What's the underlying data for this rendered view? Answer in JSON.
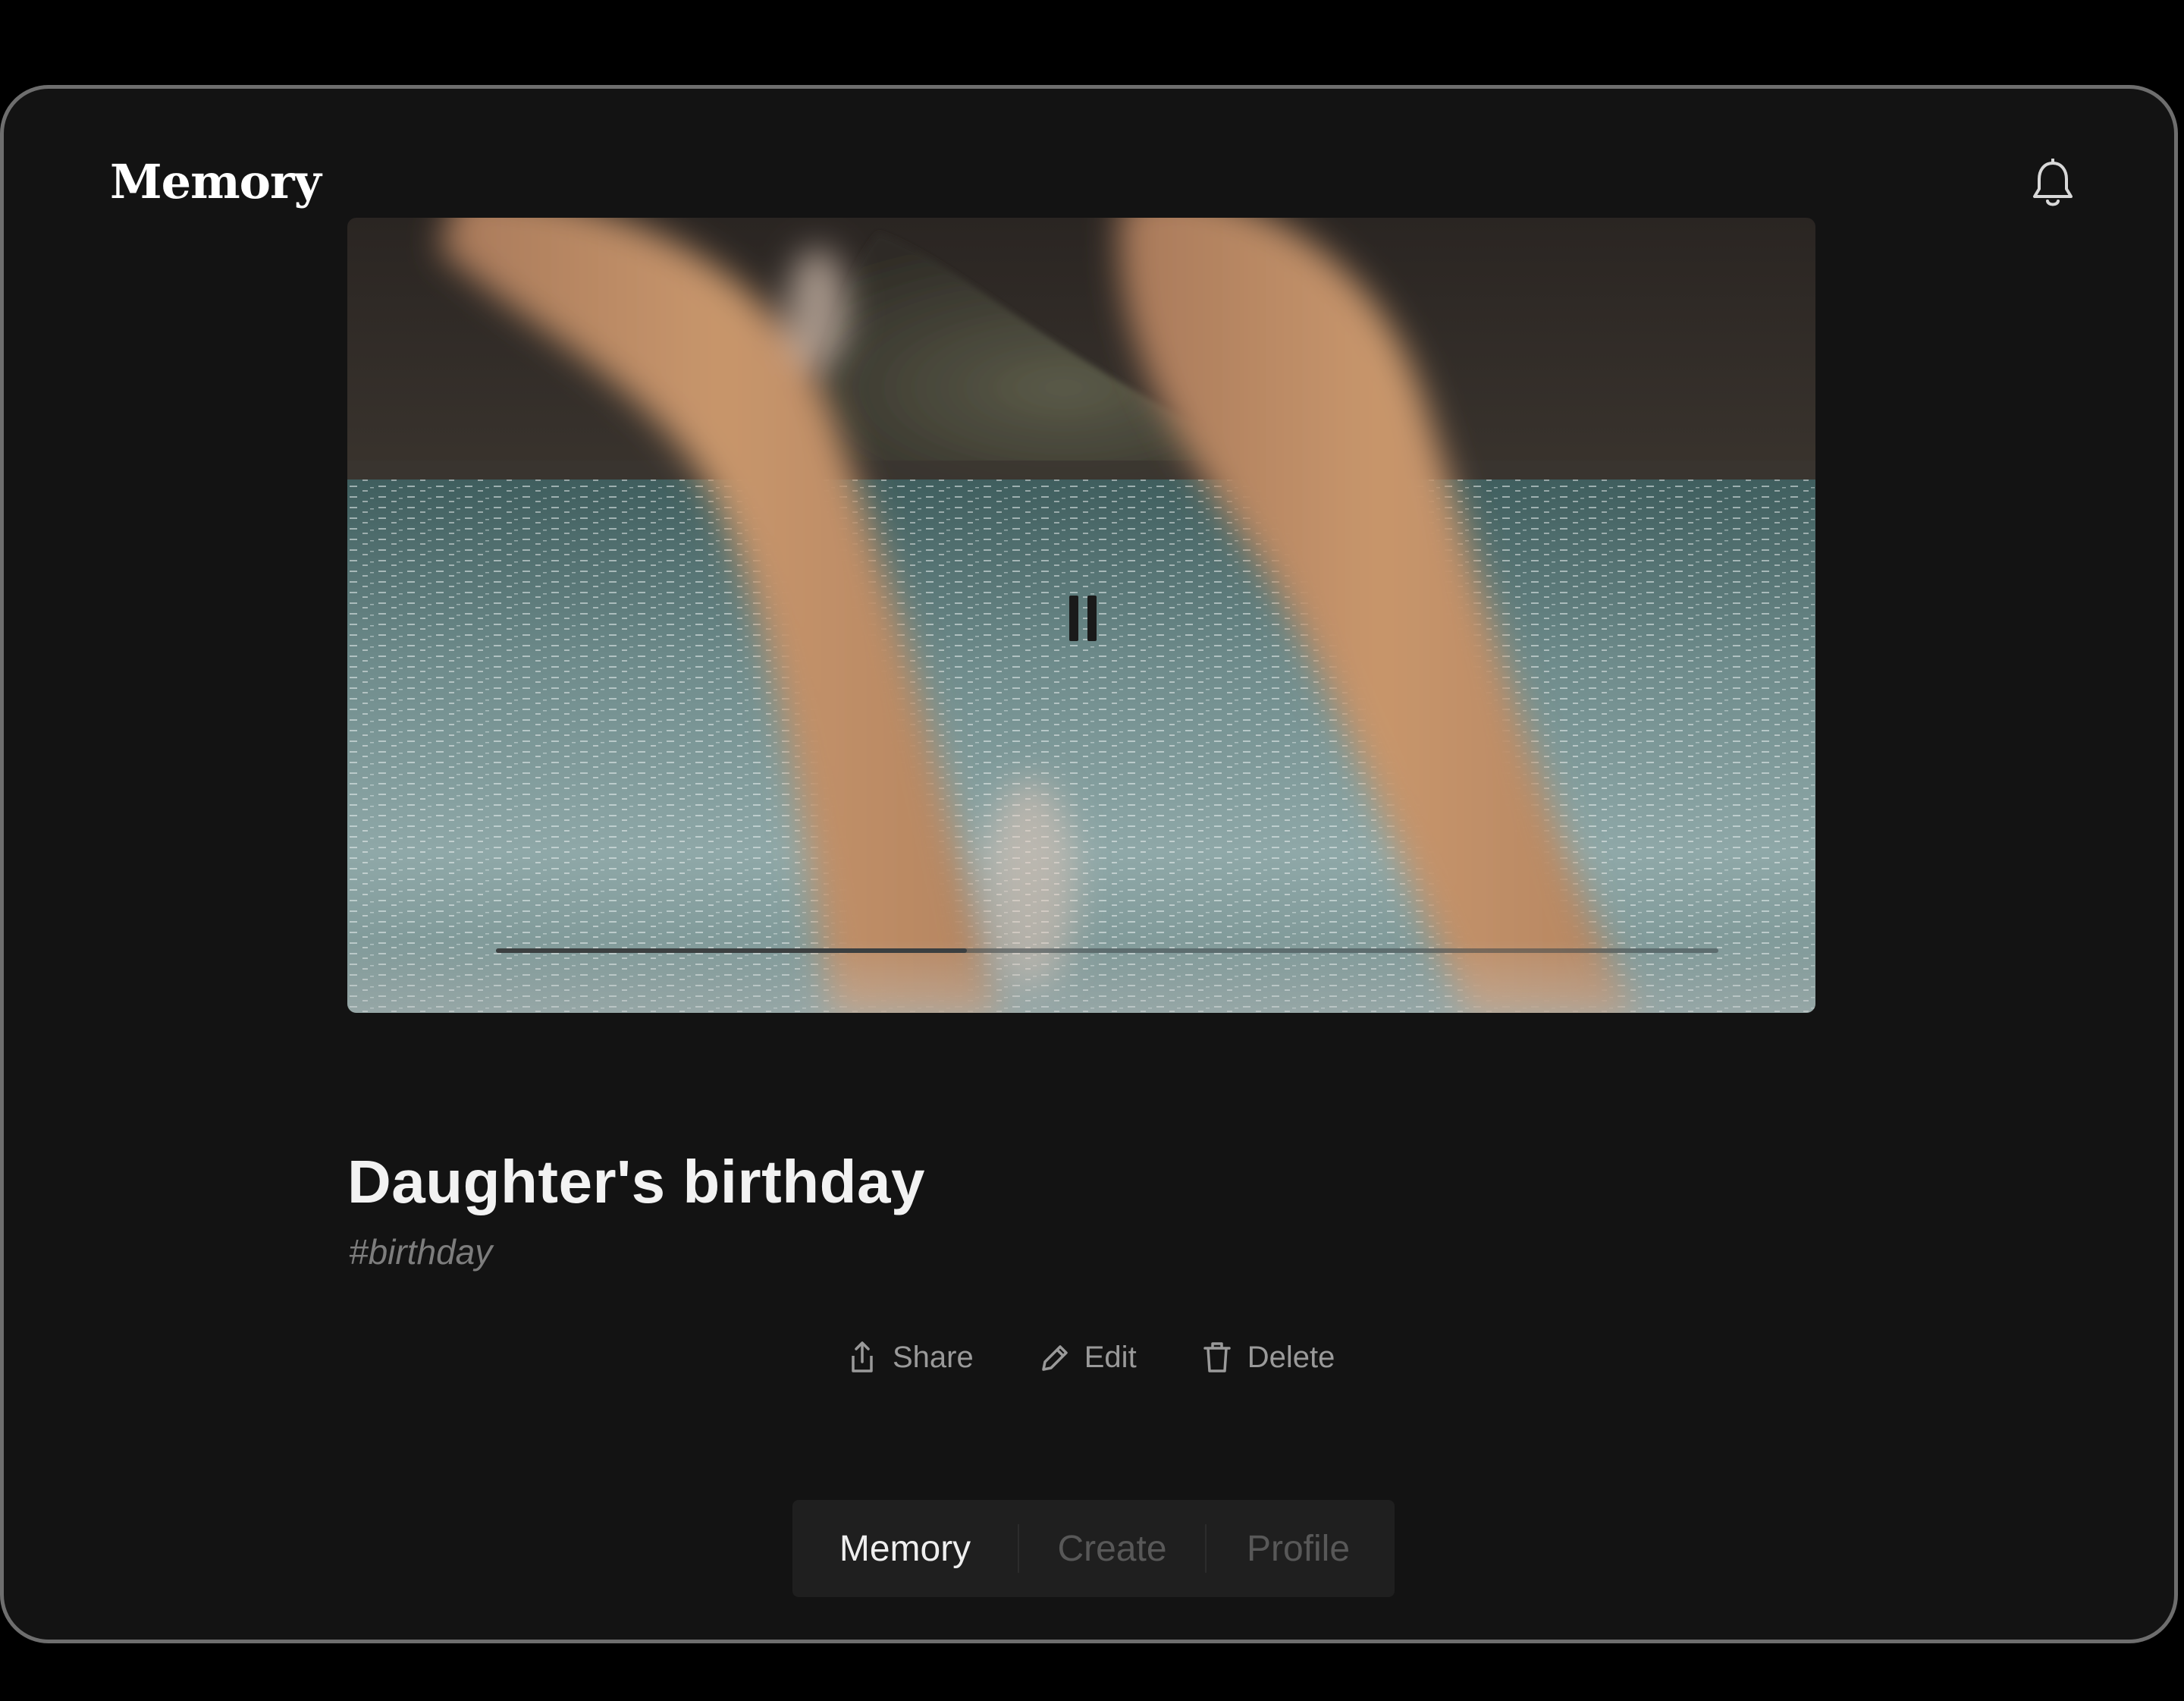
{
  "header": {
    "app_title": "Memory",
    "notifications_icon": "bell-icon"
  },
  "video": {
    "state": "playing",
    "control_icon": "pause-icon",
    "progress_fraction": 0.385
  },
  "memory": {
    "title": "Daughter's birthday",
    "tag": "#birthday"
  },
  "actions": {
    "share_label": "Share",
    "share_icon": "share-icon",
    "edit_label": "Edit",
    "edit_icon": "pencil-icon",
    "delete_label": "Delete",
    "delete_icon": "trash-icon"
  },
  "tabs": [
    {
      "label": "Memory",
      "active": true
    },
    {
      "label": "Create",
      "active": false
    },
    {
      "label": "Profile",
      "active": false
    }
  ],
  "colors": {
    "background": "#131313",
    "text_primary": "#f2f2f2",
    "text_muted": "#9a9a9a",
    "tab_inactive": "#585858",
    "tabbar_bg": "#1f1f1f"
  }
}
